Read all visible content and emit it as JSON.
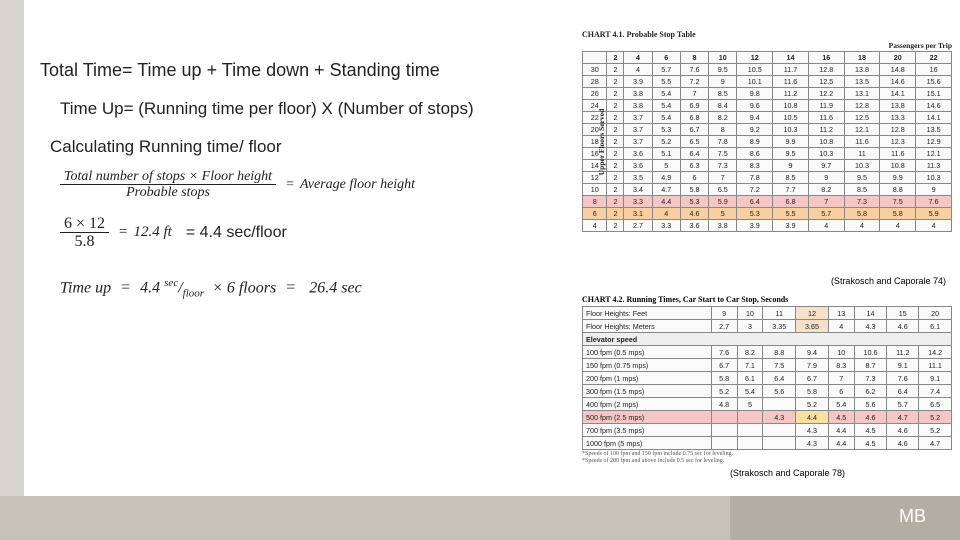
{
  "headings": {
    "total_time": "Total Time= Time up + Time down + Standing time",
    "time_up": "Time Up= (Running time per floor) X (Number of stops)",
    "calc": "Calculating Running time/ floor"
  },
  "formula1": {
    "num": "Total number of stops × Floor height",
    "den": "Probable stops",
    "rhs": "Average floor height"
  },
  "formula2": {
    "num": "6 × 12",
    "den": "5.8",
    "mid": "12.4 ft",
    "rhs": "= 4.4 sec/floor"
  },
  "formula3": {
    "lhs": "Time up",
    "eq": "=",
    "val": "4.4",
    "unitnum": "sec",
    "unitden": "floor",
    "times": "× 6 floors",
    "rhs": "26.4 sec"
  },
  "credits": {
    "c1": "(Strakosch and Caporale 74)",
    "c2": "(Strakosch and Caporale 78)"
  },
  "footer": {
    "initials": "MB"
  },
  "chart_data": [
    {
      "type": "table",
      "title": "CHART 4.1. Probable Stop Table",
      "xlabel": "Passengers per Trip",
      "ylabel": "Upper Floors Served",
      "columns": [
        2,
        4,
        6,
        8,
        10,
        12,
        14,
        16,
        18,
        20,
        22
      ],
      "rows": [
        {
          "floors": 30,
          "v": [
            2,
            4,
            5.7,
            7.6,
            9.5,
            10.5,
            11.7,
            12.8,
            13.8,
            14.8,
            16.0
          ]
        },
        {
          "floors": 28,
          "v": [
            2,
            3.9,
            5.5,
            7.2,
            9.0,
            10.1,
            11.6,
            12.5,
            13.5,
            14.6,
            15.6
          ]
        },
        {
          "floors": 26,
          "v": [
            2,
            3.8,
            5.4,
            7.0,
            8.5,
            9.8,
            11.2,
            12.2,
            13.1,
            14.1,
            15.1
          ]
        },
        {
          "floors": 24,
          "v": [
            2,
            3.8,
            5.4,
            6.9,
            8.4,
            9.6,
            10.8,
            11.9,
            12.8,
            13.8,
            14.6
          ]
        },
        {
          "floors": 22,
          "v": [
            2,
            3.7,
            5.4,
            6.8,
            8.2,
            9.4,
            10.5,
            11.6,
            12.5,
            13.3,
            14.1
          ]
        },
        {
          "floors": 20,
          "v": [
            2,
            3.7,
            5.3,
            6.7,
            8.0,
            9.2,
            10.3,
            11.2,
            12.1,
            12.8,
            13.5
          ]
        },
        {
          "floors": 18,
          "v": [
            2,
            3.7,
            5.2,
            6.5,
            7.8,
            8.9,
            9.9,
            10.8,
            11.6,
            12.3,
            12.9
          ]
        },
        {
          "floors": 16,
          "v": [
            2,
            3.6,
            5.1,
            6.4,
            7.5,
            8.6,
            9.5,
            10.3,
            11.0,
            11.6,
            12.1
          ]
        },
        {
          "floors": 14,
          "v": [
            2,
            3.6,
            5.0,
            6.3,
            7.3,
            8.3,
            9.0,
            9.7,
            10.3,
            10.8,
            11.3
          ]
        },
        {
          "floors": 12,
          "v": [
            2,
            3.5,
            4.9,
            6.0,
            7.0,
            7.8,
            8.5,
            9.0,
            9.5,
            9.9,
            10.3
          ]
        },
        {
          "floors": 10,
          "v": [
            2,
            3.4,
            4.7,
            5.8,
            6.5,
            7.2,
            7.7,
            8.2,
            8.5,
            8.8,
            9.0
          ]
        },
        {
          "floors": 8,
          "v": [
            2,
            3.3,
            4.4,
            5.3,
            5.9,
            6.4,
            6.8,
            7.0,
            7.3,
            7.5,
            7.6
          ],
          "hl": "pink"
        },
        {
          "floors": 6,
          "v": [
            2,
            3.1,
            4.0,
            4.6,
            5.0,
            5.3,
            5.5,
            5.7,
            5.8,
            5.8,
            5.9
          ],
          "hl": "orange"
        },
        {
          "floors": 4,
          "v": [
            2,
            2.7,
            3.3,
            3.6,
            3.8,
            3.9,
            3.9,
            4,
            4,
            4,
            4
          ]
        }
      ]
    },
    {
      "type": "table",
      "title": "CHART 4.2. Running Times, Car Start to Car Stop, Seconds",
      "header_ft": {
        "label": "Floor Heights: Feet",
        "v": [
          9,
          10,
          11,
          12,
          13,
          14,
          15,
          20
        ]
      },
      "header_m": {
        "label": "Floor Heights: Meters",
        "v": [
          2.7,
          3.0,
          3.35,
          3.65,
          4.0,
          4.3,
          4.6,
          6.1
        ]
      },
      "section": "Elevator speed",
      "rows": [
        {
          "label": "100 fpm (0.5 mps)",
          "v": [
            7.6,
            8.2,
            8.8,
            9.4,
            10.0,
            10.6,
            11.2,
            14.2
          ]
        },
        {
          "label": "150 fpm (0.75 mps)",
          "v": [
            6.7,
            7.1,
            7.5,
            7.9,
            8.3,
            8.7,
            9.1,
            11.1
          ]
        },
        {
          "label": "200 fpm (1 mps)",
          "v": [
            5.8,
            6.1,
            6.4,
            6.7,
            7.0,
            7.3,
            7.6,
            9.1
          ]
        },
        {
          "label": "300 fpm (1.5 mps)",
          "v": [
            5.2,
            5.4,
            5.6,
            5.8,
            6.0,
            6.2,
            6.4,
            7.4
          ]
        },
        {
          "label": "400 fpm (2 mps)",
          "v": [
            4.8,
            5.0,
            "",
            5.2,
            5.4,
            5.6,
            5.7,
            6.5
          ]
        },
        {
          "label": "500 fpm (2.5 mps)",
          "v": [
            "",
            "",
            4.3,
            4.4,
            4.5,
            4.6,
            4.7,
            5.2
          ],
          "hl": true
        },
        {
          "label": "700 fpm (3.5 mps)",
          "v": [
            "",
            "",
            "",
            4.3,
            4.4,
            4.5,
            4.6,
            5.2
          ]
        },
        {
          "label": "1000 fpm (5 mps)",
          "v": [
            "",
            "",
            "",
            4.3,
            4.4,
            4.5,
            4.6,
            4.7
          ]
        }
      ],
      "notes": [
        "*Speeds of 100 fpm and 150 fpm include 0.75 sec for leveling.",
        "*Speeds of 200 fpm and above include 0.5 sec for leveling."
      ]
    }
  ]
}
